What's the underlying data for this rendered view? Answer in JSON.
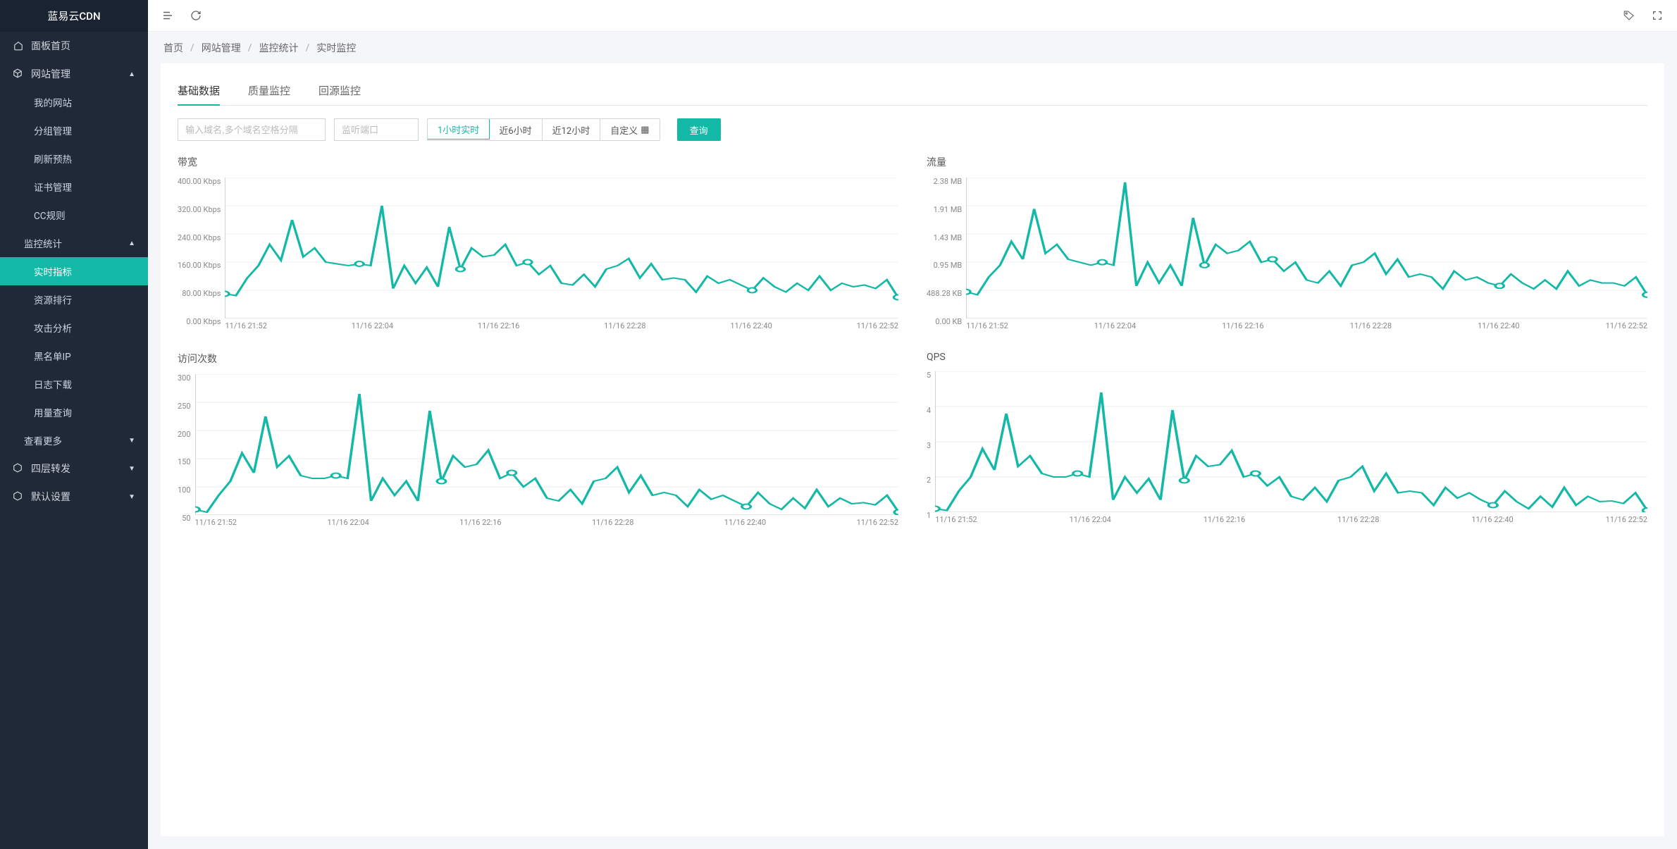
{
  "brand": "蓝易云CDN",
  "sidebar": {
    "dashboard": "面板首页",
    "site_mgmt": "网站管理",
    "site_items": [
      "我的网站",
      "分组管理",
      "刷新预热",
      "证书管理",
      "CC规则"
    ],
    "monitor_header": "监控统计",
    "monitor_items": [
      "实时指标",
      "资源排行",
      "攻击分析",
      "黑名单IP",
      "日志下载",
      "用量查询"
    ],
    "more": "查看更多",
    "l4": "四层转发",
    "defaults": "默认设置"
  },
  "breadcrumb": [
    "首页",
    "网站管理",
    "监控统计",
    "实时监控"
  ],
  "tabs": [
    "基础数据",
    "质量监控",
    "回源监控"
  ],
  "filters": {
    "domain_placeholder": "输入域名,多个域名空格分隔",
    "port_placeholder": "监听端口",
    "ranges": [
      "1小时实时",
      "近6小时",
      "近12小时"
    ],
    "custom": "自定义",
    "query": "查询"
  },
  "x_categories": [
    "11/16 21:52",
    "11/16 22:04",
    "11/16 22:16",
    "11/16 22:28",
    "11/16 22:40",
    "11/16 22:52"
  ],
  "chart_data": [
    {
      "type": "line",
      "title": "带宽",
      "ylabel": "",
      "ytick_labels": [
        "400.00 Kbps",
        "320.00 Kbps",
        "240.00 Kbps",
        "160.00 Kbps",
        "80.00 Kbps",
        "0.00 Kbps"
      ],
      "ylim": [
        0,
        400
      ],
      "categories": [
        "11/16 21:52",
        "11/16 22:04",
        "11/16 22:16",
        "11/16 22:28",
        "11/16 22:40",
        "11/16 22:52"
      ],
      "values": [
        70,
        65,
        115,
        150,
        210,
        165,
        280,
        175,
        200,
        160,
        155,
        150,
        155,
        150,
        320,
        85,
        150,
        100,
        145,
        90,
        260,
        140,
        200,
        175,
        180,
        210,
        150,
        160,
        125,
        150,
        100,
        95,
        125,
        90,
        140,
        150,
        170,
        115,
        155,
        110,
        115,
        110,
        75,
        120,
        100,
        110,
        95,
        80,
        115,
        90,
        75,
        100,
        80,
        120,
        80,
        100,
        90,
        95,
        85,
        110,
        60
      ]
    },
    {
      "type": "line",
      "title": "流量",
      "ylabel": "",
      "ytick_labels": [
        "2.38 MB",
        "1.91 MB",
        "1.43 MB",
        "0.95 MB",
        "488.28 KB",
        "0.00 KB"
      ],
      "ylim": [
        0,
        2.38
      ],
      "categories": [
        "11/16 21:52",
        "11/16 22:04",
        "11/16 22:16",
        "11/16 22:28",
        "11/16 22:40",
        "11/16 22:52"
      ],
      "values": [
        0.45,
        0.4,
        0.7,
        0.9,
        1.3,
        1.0,
        1.85,
        1.1,
        1.25,
        1.0,
        0.95,
        0.9,
        0.95,
        0.9,
        2.3,
        0.55,
        0.95,
        0.6,
        0.9,
        0.55,
        1.7,
        0.9,
        1.25,
        1.1,
        1.15,
        1.3,
        0.95,
        1.0,
        0.8,
        0.95,
        0.65,
        0.6,
        0.8,
        0.55,
        0.9,
        0.95,
        1.1,
        0.75,
        1.0,
        0.7,
        0.75,
        0.7,
        0.5,
        0.8,
        0.65,
        0.7,
        0.6,
        0.55,
        0.75,
        0.6,
        0.5,
        0.65,
        0.5,
        0.8,
        0.55,
        0.65,
        0.6,
        0.6,
        0.55,
        0.7,
        0.4
      ]
    },
    {
      "type": "line",
      "title": "访问次数",
      "ylabel": "",
      "ytick_labels": [
        "300",
        "250",
        "200",
        "150",
        "100",
        "50"
      ],
      "ylim": [
        50,
        300
      ],
      "categories": [
        "11/16 21:52",
        "11/16 22:04",
        "11/16 22:16",
        "11/16 22:28",
        "11/16 22:40",
        "11/16 22:52"
      ],
      "values": [
        60,
        55,
        85,
        110,
        160,
        125,
        225,
        135,
        155,
        120,
        115,
        115,
        120,
        115,
        265,
        75,
        115,
        85,
        110,
        75,
        235,
        110,
        155,
        135,
        140,
        165,
        115,
        125,
        100,
        115,
        80,
        75,
        95,
        70,
        110,
        115,
        135,
        90,
        120,
        85,
        90,
        85,
        65,
        95,
        78,
        85,
        75,
        65,
        90,
        70,
        60,
        80,
        62,
        95,
        65,
        80,
        70,
        72,
        68,
        85,
        55
      ]
    },
    {
      "type": "line",
      "title": "QPS",
      "ylabel": "",
      "ytick_labels": [
        "5",
        "4",
        "3",
        "2",
        "1"
      ],
      "ylim": [
        1,
        5
      ],
      "categories": [
        "11/16 21:52",
        "11/16 22:04",
        "11/16 22:16",
        "11/16 22:28",
        "11/16 22:40",
        "11/16 22:52"
      ],
      "values": [
        1.1,
        1.05,
        1.6,
        2.0,
        2.8,
        2.2,
        3.8,
        2.3,
        2.6,
        2.1,
        2.0,
        2.0,
        2.1,
        2.0,
        4.4,
        1.35,
        2.0,
        1.55,
        1.95,
        1.35,
        3.9,
        1.9,
        2.6,
        2.3,
        2.35,
        2.75,
        2.0,
        2.1,
        1.75,
        2.0,
        1.45,
        1.35,
        1.7,
        1.3,
        1.9,
        2.0,
        2.3,
        1.6,
        2.1,
        1.55,
        1.6,
        1.55,
        1.2,
        1.7,
        1.4,
        1.55,
        1.35,
        1.2,
        1.6,
        1.3,
        1.1,
        1.45,
        1.15,
        1.7,
        1.2,
        1.45,
        1.3,
        1.32,
        1.25,
        1.55,
        1.05
      ]
    }
  ]
}
